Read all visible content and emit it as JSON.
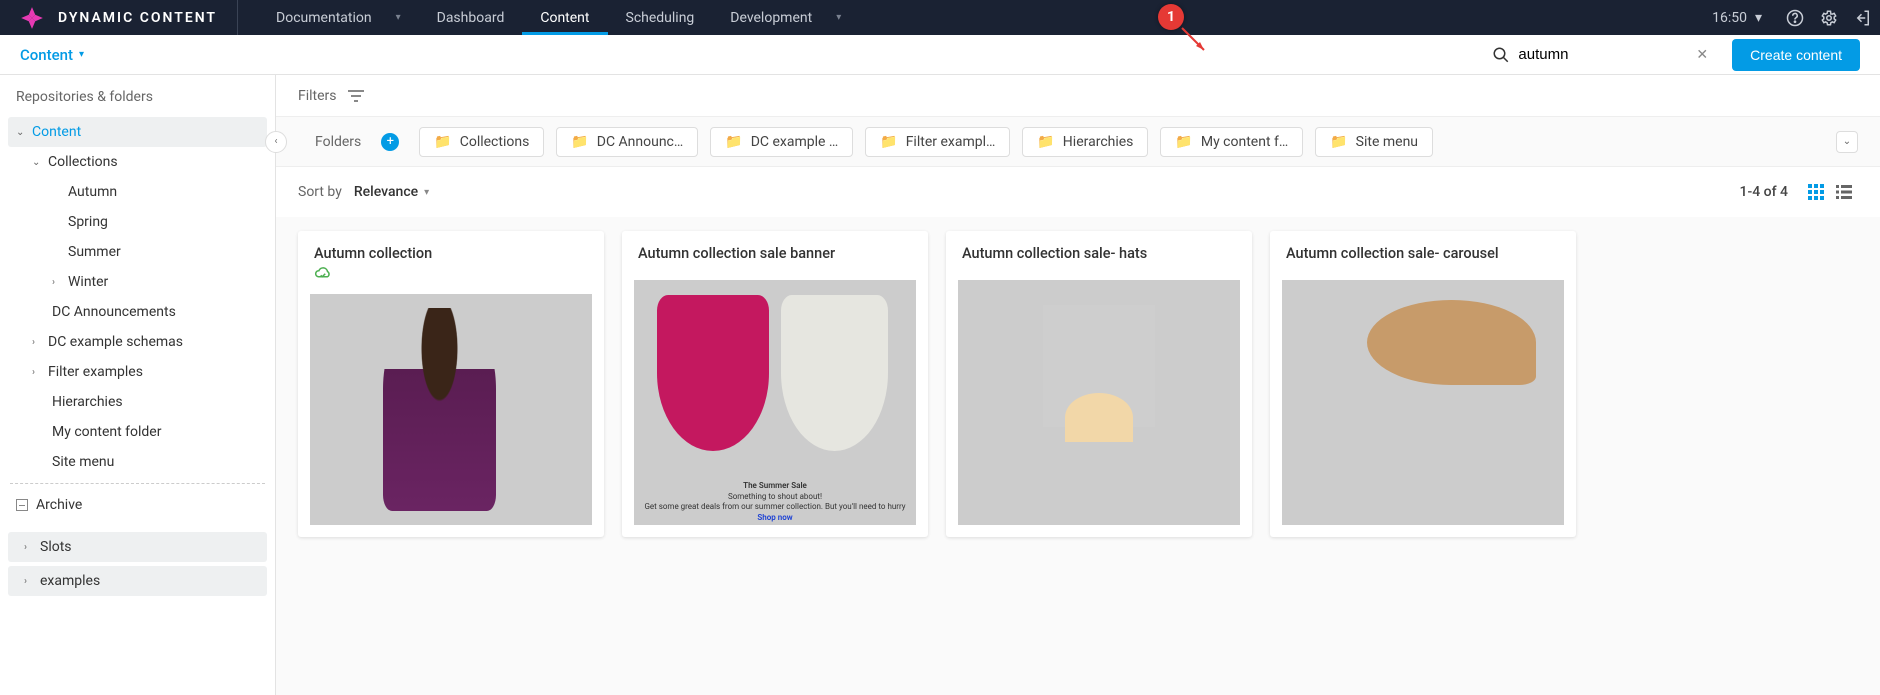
{
  "annotation": {
    "num": "1"
  },
  "topnav": {
    "brand": "DYNAMIC CONTENT",
    "items": [
      {
        "label": "Documentation",
        "hasDropdown": true
      },
      {
        "label": "Dashboard"
      },
      {
        "label": "Content",
        "active": true
      },
      {
        "label": "Scheduling"
      },
      {
        "label": "Development",
        "hasDropdown": true
      }
    ],
    "time": "16:50"
  },
  "subbar": {
    "content_label": "Content",
    "search_value": "autumn",
    "create_label": "Create content"
  },
  "sidebar": {
    "heading": "Repositories & folders",
    "tree": {
      "content": "Content",
      "collections": "Collections",
      "leaves": [
        "Autumn",
        "Spring",
        "Summer",
        "Winter"
      ],
      "others": [
        "DC Announcements",
        "DC example schemas",
        "Filter examples",
        "Hierarchies",
        "My content folder",
        "Site menu"
      ],
      "archive": "Archive",
      "sections": [
        "Slots",
        "examples"
      ]
    }
  },
  "filters": {
    "label": "Filters"
  },
  "folders": {
    "label": "Folders",
    "chips": [
      "Collections",
      "DC Announc…",
      "DC example …",
      "Filter exampl…",
      "Hierarchies",
      "My content f…",
      "Site menu"
    ]
  },
  "sort": {
    "label": "Sort by",
    "value": "Relevance",
    "count": "1-4 of 4"
  },
  "cards": [
    {
      "title": "Autumn collection",
      "status": "published"
    },
    {
      "title": "Autumn collection sale banner",
      "caption": {
        "t1": "The Summer Sale",
        "t2": "Something to shout about!",
        "t3": "Get some great deals from our summer collection. But you'll need to hurry",
        "t4": "Shop now"
      }
    },
    {
      "title": "Autumn collection sale- hats"
    },
    {
      "title": "Autumn collection sale- carousel"
    }
  ]
}
